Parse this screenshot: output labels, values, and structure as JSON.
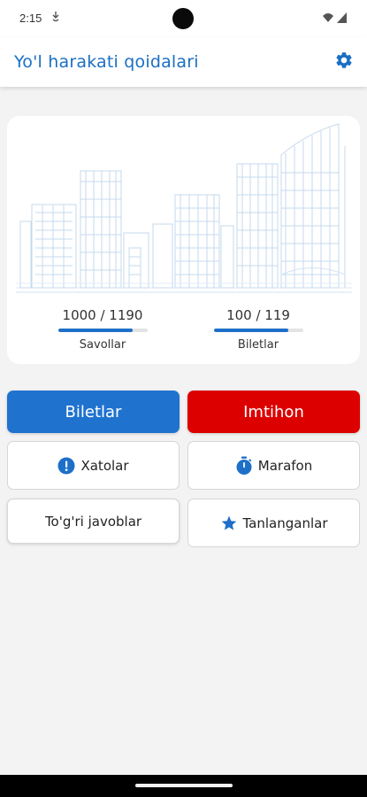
{
  "status_bar": {
    "time": "2:15"
  },
  "app_bar": {
    "title": "Yo'l harakati qoidalari",
    "settings_icon": "gear-icon",
    "accent_color": "#1a6fc4"
  },
  "stats": {
    "questions": {
      "value": "1000 / 1190",
      "label": "Savollar",
      "progress": 0.84
    },
    "tickets": {
      "value": "100 / 119",
      "label": "Biletlar",
      "progress": 0.84
    }
  },
  "buttons": {
    "tickets": {
      "label": "Biletlar",
      "color": "#1f73cf"
    },
    "exam": {
      "label": "Imtihon",
      "color": "#dc0000"
    },
    "errors": {
      "label": "Xatolar",
      "icon": "exclamation-circle-icon"
    },
    "marathon": {
      "label": "Marafon",
      "icon": "stopwatch-icon"
    },
    "correct_answers": {
      "label": "To'g'ri javoblar"
    },
    "favorites": {
      "label": "Tanlanganlar",
      "icon": "star-icon"
    }
  }
}
